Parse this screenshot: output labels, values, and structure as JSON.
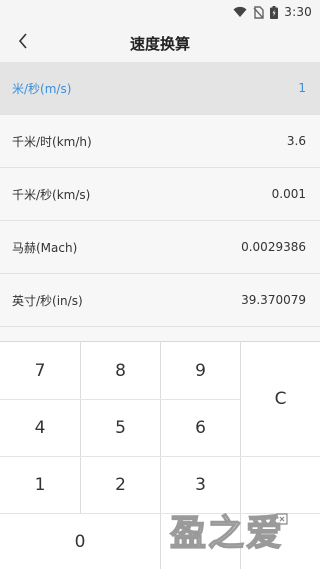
{
  "status_bar": {
    "time": "3:30"
  },
  "header": {
    "title": "速度换算"
  },
  "units": [
    {
      "name": "米/秒(m/s)",
      "value": "1",
      "active": true
    },
    {
      "name": "千米/时(km/h)",
      "value": "3.6"
    },
    {
      "name": "千米/秒(km/s)",
      "value": "0.001"
    },
    {
      "name": "马赫(Mach)",
      "value": "0.0029386"
    },
    {
      "name": "英寸/秒(in/s)",
      "value": "39.370079"
    }
  ],
  "keypad": {
    "k7": "7",
    "k8": "8",
    "k9": "9",
    "clear": "C",
    "k4": "4",
    "k5": "5",
    "k6": "6",
    "k1": "1",
    "k2": "2",
    "k3": "3",
    "k0": "0"
  },
  "watermark": {
    "text": "盈之爱"
  },
  "colors": {
    "accent": "#3b8fd9",
    "active_row_bg": "#e4e4e4"
  }
}
